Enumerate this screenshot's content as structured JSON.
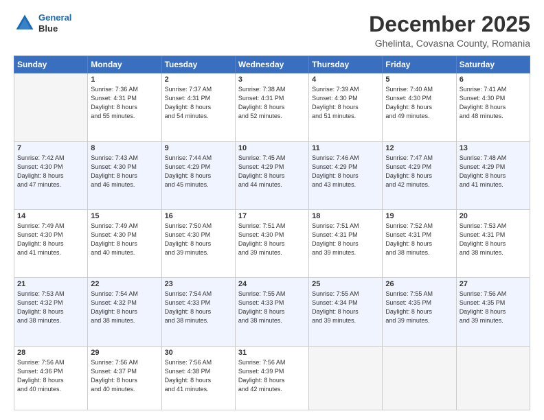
{
  "header": {
    "logo_line1": "General",
    "logo_line2": "Blue",
    "month_title": "December 2025",
    "subtitle": "Ghelinta, Covasna County, Romania"
  },
  "days_of_week": [
    "Sunday",
    "Monday",
    "Tuesday",
    "Wednesday",
    "Thursday",
    "Friday",
    "Saturday"
  ],
  "weeks": [
    [
      {
        "day": "",
        "info": ""
      },
      {
        "day": "1",
        "info": "Sunrise: 7:36 AM\nSunset: 4:31 PM\nDaylight: 8 hours\nand 55 minutes."
      },
      {
        "day": "2",
        "info": "Sunrise: 7:37 AM\nSunset: 4:31 PM\nDaylight: 8 hours\nand 54 minutes."
      },
      {
        "day": "3",
        "info": "Sunrise: 7:38 AM\nSunset: 4:31 PM\nDaylight: 8 hours\nand 52 minutes."
      },
      {
        "day": "4",
        "info": "Sunrise: 7:39 AM\nSunset: 4:30 PM\nDaylight: 8 hours\nand 51 minutes."
      },
      {
        "day": "5",
        "info": "Sunrise: 7:40 AM\nSunset: 4:30 PM\nDaylight: 8 hours\nand 49 minutes."
      },
      {
        "day": "6",
        "info": "Sunrise: 7:41 AM\nSunset: 4:30 PM\nDaylight: 8 hours\nand 48 minutes."
      }
    ],
    [
      {
        "day": "7",
        "info": "Sunrise: 7:42 AM\nSunset: 4:30 PM\nDaylight: 8 hours\nand 47 minutes."
      },
      {
        "day": "8",
        "info": "Sunrise: 7:43 AM\nSunset: 4:30 PM\nDaylight: 8 hours\nand 46 minutes."
      },
      {
        "day": "9",
        "info": "Sunrise: 7:44 AM\nSunset: 4:29 PM\nDaylight: 8 hours\nand 45 minutes."
      },
      {
        "day": "10",
        "info": "Sunrise: 7:45 AM\nSunset: 4:29 PM\nDaylight: 8 hours\nand 44 minutes."
      },
      {
        "day": "11",
        "info": "Sunrise: 7:46 AM\nSunset: 4:29 PM\nDaylight: 8 hours\nand 43 minutes."
      },
      {
        "day": "12",
        "info": "Sunrise: 7:47 AM\nSunset: 4:29 PM\nDaylight: 8 hours\nand 42 minutes."
      },
      {
        "day": "13",
        "info": "Sunrise: 7:48 AM\nSunset: 4:29 PM\nDaylight: 8 hours\nand 41 minutes."
      }
    ],
    [
      {
        "day": "14",
        "info": "Sunrise: 7:49 AM\nSunset: 4:30 PM\nDaylight: 8 hours\nand 41 minutes."
      },
      {
        "day": "15",
        "info": "Sunrise: 7:49 AM\nSunset: 4:30 PM\nDaylight: 8 hours\nand 40 minutes."
      },
      {
        "day": "16",
        "info": "Sunrise: 7:50 AM\nSunset: 4:30 PM\nDaylight: 8 hours\nand 39 minutes."
      },
      {
        "day": "17",
        "info": "Sunrise: 7:51 AM\nSunset: 4:30 PM\nDaylight: 8 hours\nand 39 minutes."
      },
      {
        "day": "18",
        "info": "Sunrise: 7:51 AM\nSunset: 4:31 PM\nDaylight: 8 hours\nand 39 minutes."
      },
      {
        "day": "19",
        "info": "Sunrise: 7:52 AM\nSunset: 4:31 PM\nDaylight: 8 hours\nand 38 minutes."
      },
      {
        "day": "20",
        "info": "Sunrise: 7:53 AM\nSunset: 4:31 PM\nDaylight: 8 hours\nand 38 minutes."
      }
    ],
    [
      {
        "day": "21",
        "info": "Sunrise: 7:53 AM\nSunset: 4:32 PM\nDaylight: 8 hours\nand 38 minutes."
      },
      {
        "day": "22",
        "info": "Sunrise: 7:54 AM\nSunset: 4:32 PM\nDaylight: 8 hours\nand 38 minutes."
      },
      {
        "day": "23",
        "info": "Sunrise: 7:54 AM\nSunset: 4:33 PM\nDaylight: 8 hours\nand 38 minutes."
      },
      {
        "day": "24",
        "info": "Sunrise: 7:55 AM\nSunset: 4:33 PM\nDaylight: 8 hours\nand 38 minutes."
      },
      {
        "day": "25",
        "info": "Sunrise: 7:55 AM\nSunset: 4:34 PM\nDaylight: 8 hours\nand 39 minutes."
      },
      {
        "day": "26",
        "info": "Sunrise: 7:55 AM\nSunset: 4:35 PM\nDaylight: 8 hours\nand 39 minutes."
      },
      {
        "day": "27",
        "info": "Sunrise: 7:56 AM\nSunset: 4:35 PM\nDaylight: 8 hours\nand 39 minutes."
      }
    ],
    [
      {
        "day": "28",
        "info": "Sunrise: 7:56 AM\nSunset: 4:36 PM\nDaylight: 8 hours\nand 40 minutes."
      },
      {
        "day": "29",
        "info": "Sunrise: 7:56 AM\nSunset: 4:37 PM\nDaylight: 8 hours\nand 40 minutes."
      },
      {
        "day": "30",
        "info": "Sunrise: 7:56 AM\nSunset: 4:38 PM\nDaylight: 8 hours\nand 41 minutes."
      },
      {
        "day": "31",
        "info": "Sunrise: 7:56 AM\nSunset: 4:39 PM\nDaylight: 8 hours\nand 42 minutes."
      },
      {
        "day": "",
        "info": ""
      },
      {
        "day": "",
        "info": ""
      },
      {
        "day": "",
        "info": ""
      }
    ]
  ]
}
